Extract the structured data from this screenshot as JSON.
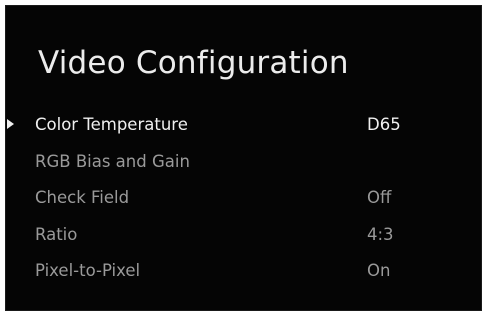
{
  "screen": {
    "title": "Video Configuration"
  },
  "menu": {
    "selected_index": 0,
    "items": [
      {
        "label": "Color Temperature",
        "value": "D65"
      },
      {
        "label": "RGB Bias and Gain",
        "value": ""
      },
      {
        "label": "Check Field",
        "value": "Off"
      },
      {
        "label": "Ratio",
        "value": "4:3"
      },
      {
        "label": "Pixel-to-Pixel",
        "value": "On"
      }
    ]
  },
  "colors": {
    "background": "#050505",
    "selected_text": "#f0f0f0",
    "unselected_text": "#9a9a9a"
  },
  "icons": {
    "cursor": "triangle-right-icon"
  }
}
